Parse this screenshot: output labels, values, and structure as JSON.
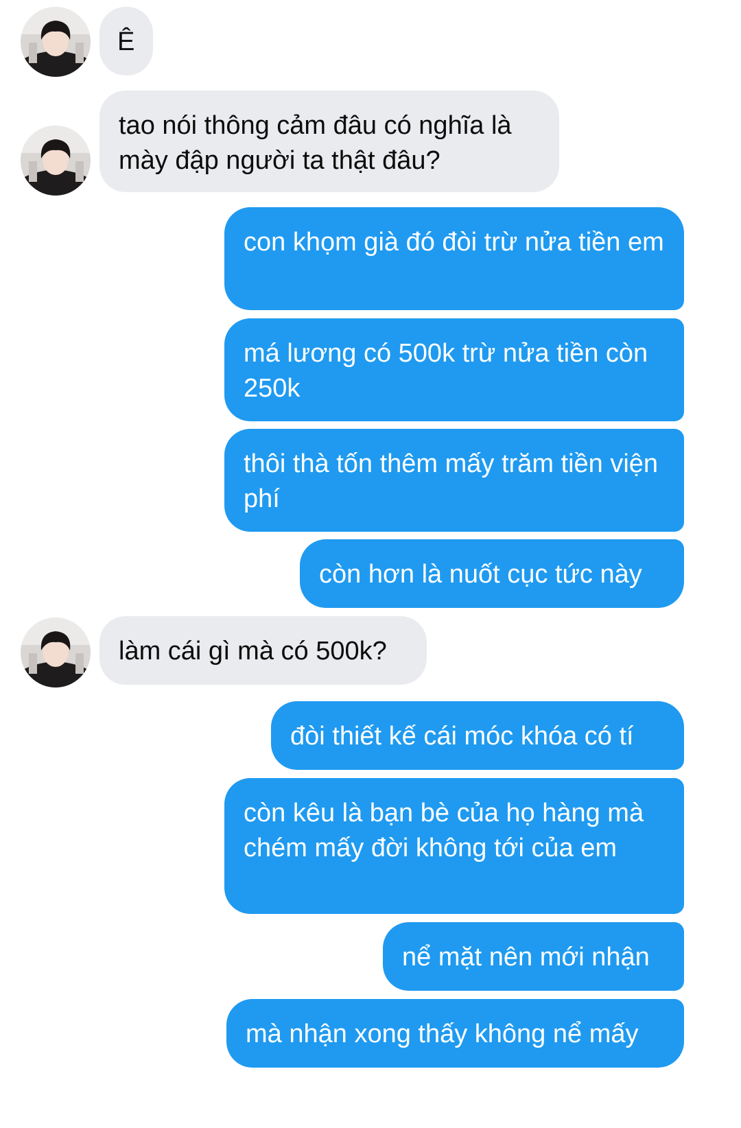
{
  "colors": {
    "background": "#ffffff",
    "incoming_bubble": "#e9ebee",
    "outgoing_bubble": "#1f9af0",
    "incoming_text": "#0c0c0c",
    "outgoing_text": "#ffffff"
  },
  "icons": {
    "avatar": "contact-avatar-photo"
  },
  "messages": [
    {
      "sender": "contact",
      "text": "Ê"
    },
    {
      "sender": "contact",
      "text": "tao nói thông cảm đâu có nghĩa là mày đập người ta thật đâu?"
    },
    {
      "sender": "me",
      "text": "con khọm già đó đòi trừ nửa tiền em"
    },
    {
      "sender": "me",
      "text": "má lương có 500k trừ nửa tiền còn 250k"
    },
    {
      "sender": "me",
      "text": "thôi thà tốn thêm mấy trăm tiền viện phí"
    },
    {
      "sender": "me",
      "text": "còn hơn là nuốt cục tức này"
    },
    {
      "sender": "contact",
      "text": "làm cái gì mà có 500k?"
    },
    {
      "sender": "me",
      "text": "đòi thiết kế cái móc khóa có tí"
    },
    {
      "sender": "me",
      "text": "còn kêu là bạn bè của họ hàng mà chém mấy đời không tới của em"
    },
    {
      "sender": "me",
      "text": "nể mặt nên mới nhận"
    },
    {
      "sender": "me",
      "text": "mà nhận xong thấy không nể mấy"
    }
  ]
}
